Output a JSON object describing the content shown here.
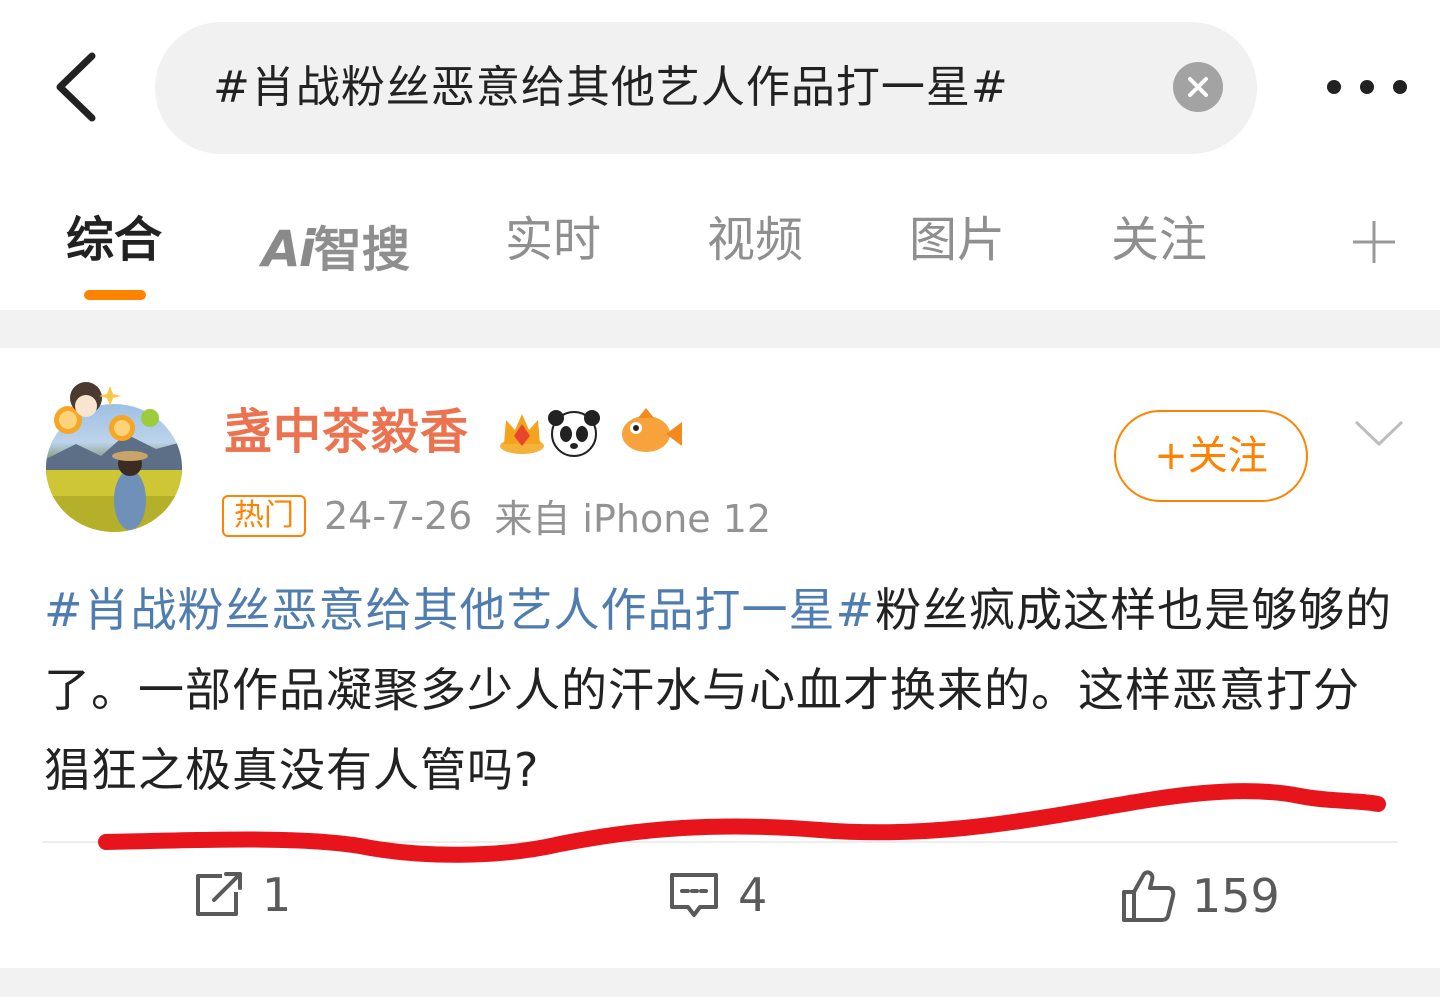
{
  "search": {
    "query": "#肖战粉丝恶意给其他艺人作品打一星#"
  },
  "tabs": [
    {
      "label": "综合",
      "active": true
    },
    {
      "label": "智搜",
      "ai_prefix": "Ai"
    },
    {
      "label": "实时"
    },
    {
      "label": "视频"
    },
    {
      "label": "图片"
    },
    {
      "label": "关注"
    }
  ],
  "post": {
    "author": "盏中茶毅香",
    "hot_tag": "热门",
    "date": "24-7-26",
    "source": "来自 iPhone 12",
    "follow_label": "+关注",
    "hashtag": "#肖战粉丝恶意给其他艺人作品打一星#",
    "body": "粉丝疯成这样也是够够的了。一部作品凝聚多少人的汗水与心血才换来的。这样恶意打分猖狂之极真没有人管吗?",
    "actions": {
      "repost_count": "1",
      "comment_count": "4",
      "like_count": "159"
    }
  },
  "colors": {
    "accent": "#ff8200",
    "username": "#eb7350",
    "hashtag": "#507daf",
    "annotation": "#e8141c"
  },
  "icons": [
    "back-arrow-icon",
    "clear-icon",
    "more-icon",
    "plus-icon",
    "chevron-down-icon",
    "repost-icon",
    "comment-icon",
    "like-icon"
  ]
}
